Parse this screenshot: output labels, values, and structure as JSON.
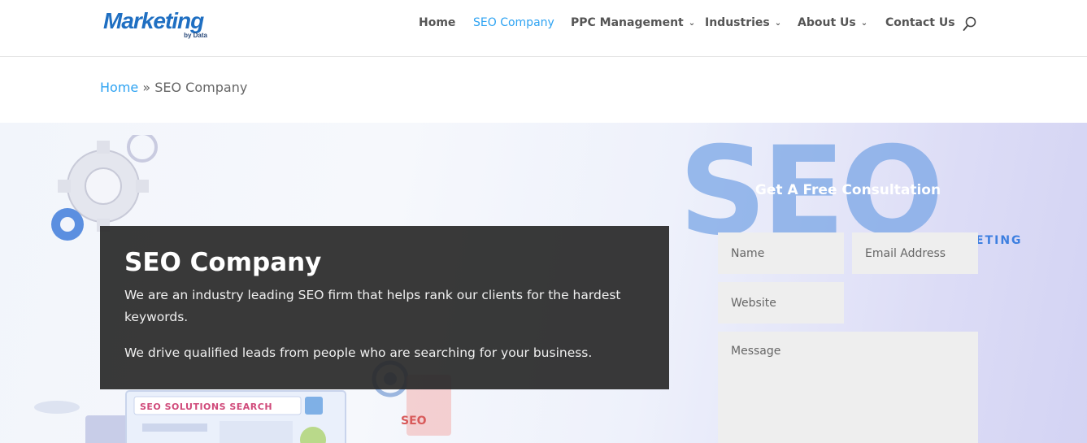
{
  "brand": {
    "logo_text": "Marketing",
    "logo_sub": "by Data",
    "colors": {
      "accent": "#2ea3f2",
      "logo": "#1f6fc2"
    }
  },
  "nav": {
    "items": [
      {
        "label": "Home",
        "dropdown": false,
        "active": false
      },
      {
        "label": "SEO Company",
        "dropdown": false,
        "active": true
      },
      {
        "label": "PPC Management",
        "dropdown": true,
        "active": false
      },
      {
        "label": "Industries",
        "dropdown": true,
        "active": false
      },
      {
        "label": "About Us",
        "dropdown": true,
        "active": false
      },
      {
        "label": "Contact Us",
        "dropdown": false,
        "active": false
      }
    ],
    "search_icon": "search-icon"
  },
  "breadcrumb": {
    "home": "Home",
    "separator": "»",
    "current": "SEO Company"
  },
  "hero": {
    "title": "SEO Company",
    "paragraph_1": "We are an industry leading SEO firm that helps rank our clients for the hardest keywords.",
    "paragraph_2": "We drive qualified leads from people who are searching for your business.",
    "background_watermark": "SEO",
    "background_watermark_sub": "ETING",
    "illustration_label": "SEO SOLUTIONS SEARCH",
    "illustration_badge": "SEO"
  },
  "form": {
    "title": "Get A Free Consultation",
    "name_placeholder": "Name",
    "email_placeholder": "Email Address",
    "website_placeholder": "Website",
    "message_placeholder": "Message"
  }
}
